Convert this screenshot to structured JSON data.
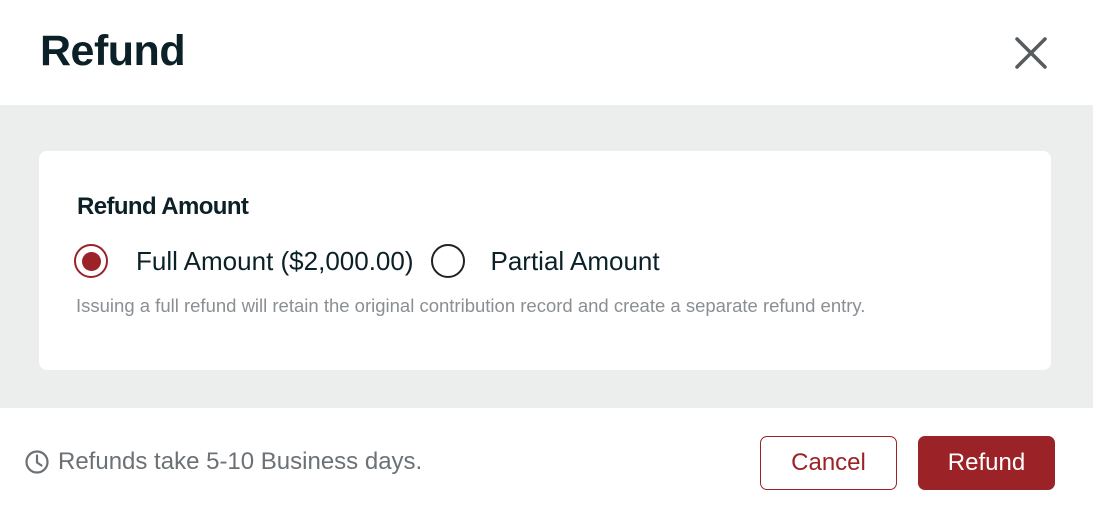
{
  "dialog": {
    "title": "Refund",
    "close_icon": "close-icon"
  },
  "refund_amount": {
    "label": "Refund Amount",
    "options": [
      {
        "label": "Full Amount ($2,000.00)",
        "selected": true
      },
      {
        "label": "Partial Amount",
        "selected": false
      }
    ],
    "helper_text": "Issuing a full refund will retain the original contribution record and create a separate refund entry."
  },
  "footer": {
    "note_icon": "clock-icon",
    "note": "Refunds take 5-10 Business days.",
    "cancel_label": "Cancel",
    "refund_label": "Refund"
  },
  "colors": {
    "accent": "#9b2226",
    "title_text": "#0b2027",
    "body_background": "#eceeee",
    "helper_text": "#8a8f93"
  }
}
